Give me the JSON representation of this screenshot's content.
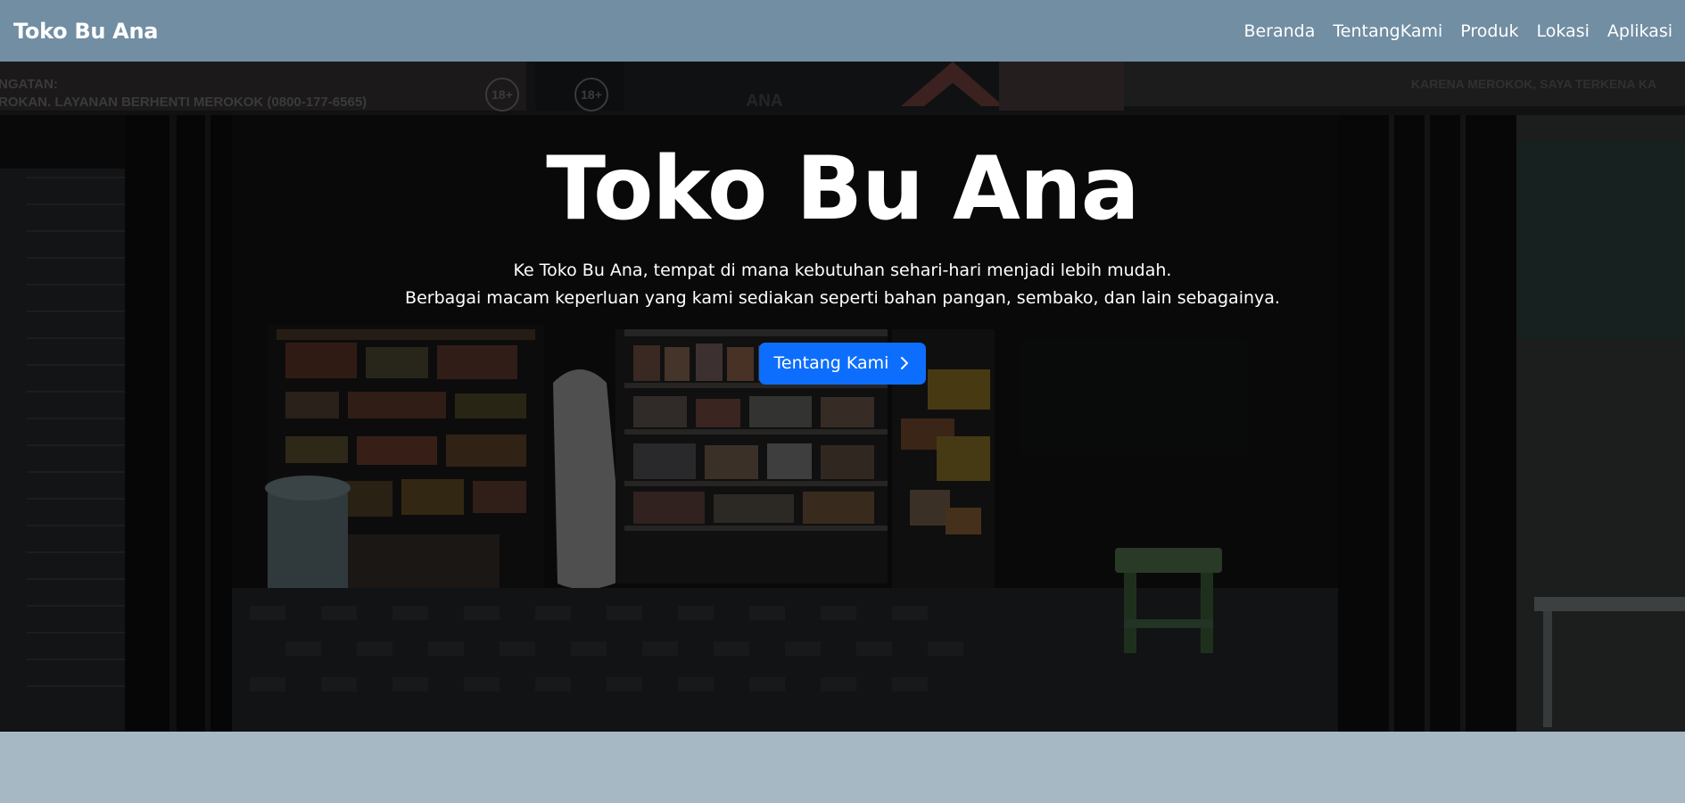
{
  "navbar": {
    "brand": "Toko Bu Ana",
    "links": [
      "Beranda",
      "TentangKami",
      "Produk",
      "Lokasi",
      "Aplikasi"
    ]
  },
  "hero": {
    "title": "Toko Bu Ana",
    "lead_line1": "Ke Toko Bu Ana, tempat di mana kebutuhan sehari-hari menjadi lebih mudah.",
    "lead_line2": "Berbagai macam keperluan yang kami sediakan seperti bahan pangan, sembako, dan lain sebagainya.",
    "button_label": "Tentang Kami",
    "button_icon": "chevron-right-icon",
    "banner_left_line1": "NGATAN:",
    "banner_left_line2": "ROKAN. LAYANAN BERHENTI MEROKOK (0800-177-6565)",
    "badge_label": "18+",
    "sign_center": "ANA",
    "banner_right": "KARENA MEROKOK, SAYA TERKENA KA"
  },
  "colors": {
    "navbar_bg": "#718ea3",
    "button_bg": "#0d6efd",
    "page_bg": "#a7b8c5"
  }
}
